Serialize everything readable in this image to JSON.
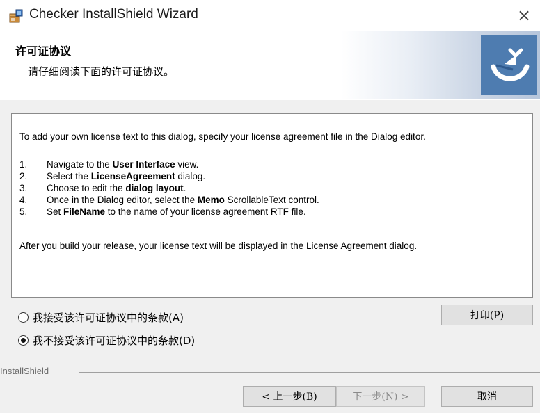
{
  "window": {
    "title": "Checker InstallShield Wizard",
    "close_glyph": "×"
  },
  "header": {
    "title": "许可证协议",
    "subtitle": "请仔细阅读下面的许可证协议。"
  },
  "license": {
    "intro": "To add your own license text to this dialog, specify your license agreement file in the Dialog editor.",
    "steps": [
      {
        "num": "1.",
        "before": "Navigate to the ",
        "bold": "User Interface",
        "after": " view."
      },
      {
        "num": "2.",
        "before": "Select the ",
        "bold": "LicenseAgreement",
        "after": " dialog."
      },
      {
        "num": "3.",
        "before": "Choose to edit the ",
        "bold": "dialog layout",
        "after": "."
      },
      {
        "num": "4.",
        "before": "Once in the Dialog editor, select the ",
        "bold": "Memo",
        "after": " ScrollableText control."
      },
      {
        "num": "5.",
        "before": "Set ",
        "bold": "FileName",
        "after": " to the name of your license agreement RTF file."
      }
    ],
    "outro": "After you build your release, your license text will be displayed in the License Agreement dialog."
  },
  "options": {
    "accept": {
      "label": "我接受该许可证协议中的条款(A)",
      "checked": false
    },
    "decline": {
      "label": "我不接受该许可证协议中的条款(D)",
      "checked": true
    }
  },
  "buttons": {
    "print": "打印(P)",
    "back": "< 上一步(B)",
    "next": "下一步(N) >",
    "cancel": "取消"
  },
  "brand": "InstallShield",
  "colors": {
    "logo_blue": "#4e7cb0",
    "dialog_bg": "#f0f0f0"
  },
  "icons": {
    "app": "installer-box-icon",
    "logo": "installshield-logo-icon",
    "close": "close-icon"
  }
}
